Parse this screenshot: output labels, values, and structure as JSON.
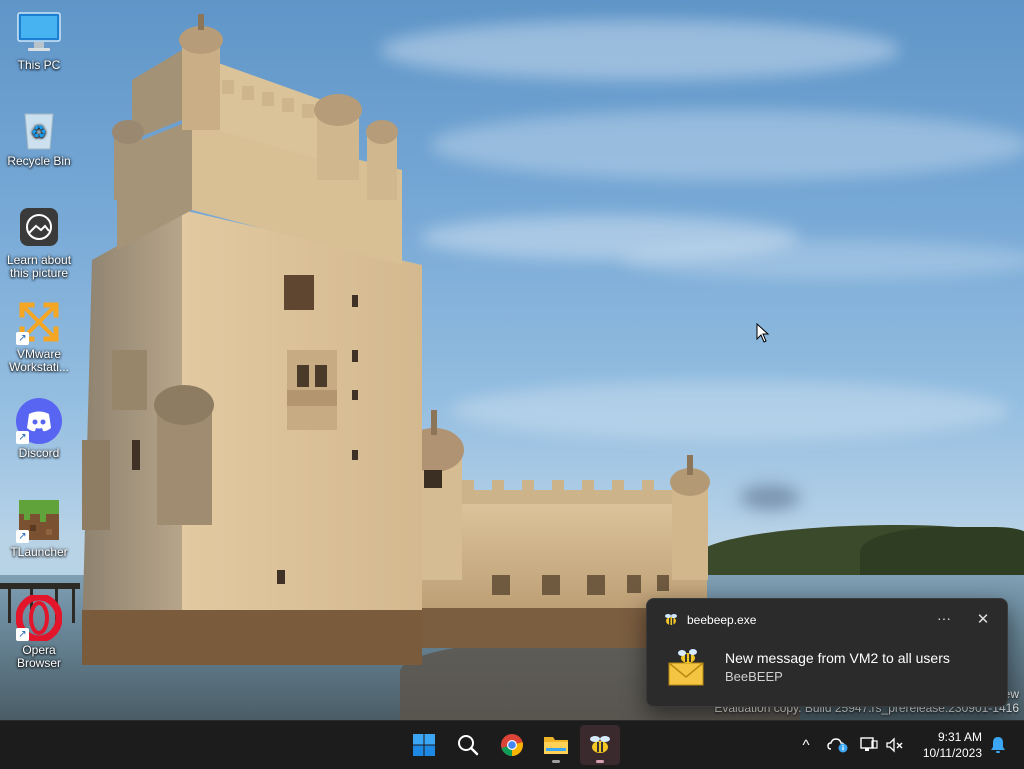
{
  "desktop": {
    "icons": [
      {
        "label": "This PC",
        "icon": "monitor-icon"
      },
      {
        "label": "Recycle Bin",
        "icon": "recycle-bin-icon"
      },
      {
        "label": "Learn about this picture",
        "icon": "camera-icon"
      },
      {
        "label": "VMware Workstati...",
        "icon": "vmware-icon"
      },
      {
        "label": "Discord",
        "icon": "discord-icon"
      },
      {
        "label": "TLauncher",
        "icon": "minecraft-block-icon"
      },
      {
        "label": "Opera Browser",
        "icon": "opera-icon"
      }
    ],
    "watermark": {
      "line1": "ew",
      "line2": "Evaluation copy. Build 25947.rs_prerelease.230901-1416"
    }
  },
  "notification": {
    "app_name": "beebeep.exe",
    "more_glyph": "···",
    "close_glyph": "✕",
    "title": "New message from VM2 to all users",
    "body": "BeeBEEP"
  },
  "taskbar": {
    "apps": [
      {
        "name": "Start",
        "icon": "windows-start-icon"
      },
      {
        "name": "Search",
        "icon": "search-icon"
      },
      {
        "name": "Google Chrome",
        "icon": "chrome-icon"
      },
      {
        "name": "File Explorer",
        "icon": "folder-icon"
      },
      {
        "name": "BeeBEEP",
        "icon": "bee-icon"
      }
    ],
    "tray": {
      "chevron": "^",
      "time": "9:31 AM",
      "date": "10/11/2023"
    }
  },
  "colors": {
    "taskbar_bg": "#1c1c1c",
    "toast_bg": "#2b2b2b",
    "windows_blue": "#1a9df0"
  }
}
